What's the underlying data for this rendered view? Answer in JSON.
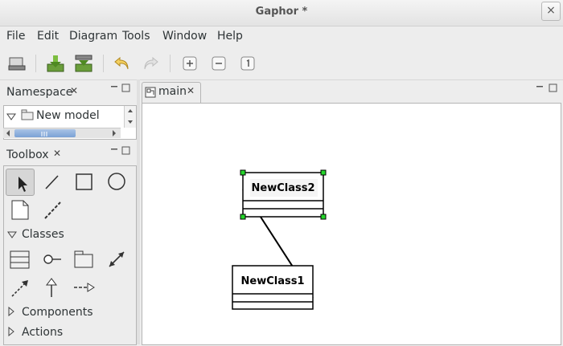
{
  "window": {
    "title": "Gaphor *",
    "close_glyph": "×"
  },
  "menu": [
    "File",
    "Edit",
    "Diagram",
    "Tools",
    "Window",
    "Help"
  ],
  "toolbar": {
    "buttons": [
      "open-model-icon",
      "import-icon",
      "export-icon",
      "undo-icon",
      "redo-icon",
      "zoom-in-icon",
      "zoom-out-icon",
      "zoom-100-icon"
    ]
  },
  "namespace": {
    "title": "Namespace",
    "tree": [
      {
        "label": "New model",
        "expanded": true
      }
    ]
  },
  "toolbox": {
    "title": "Toolbox",
    "sections": {
      "classes": "Classes",
      "components": "Components",
      "actions": "Actions"
    },
    "tools_row1": [
      "pointer-tool",
      "line-tool",
      "box-tool",
      "ellipse-tool"
    ],
    "tools_row2": [
      "comment-tool",
      "comment-line-tool"
    ],
    "class_tools_row1": [
      "class-tool",
      "interface-tool",
      "package-tool",
      "association-tool"
    ],
    "class_tools_row2": [
      "dependency-tool",
      "generalization-tool",
      "implementation-tool"
    ]
  },
  "diagram": {
    "tab_label": "main",
    "classes": [
      {
        "name": "NewClass2",
        "selected": true
      },
      {
        "name": "NewClass1",
        "selected": false
      }
    ]
  },
  "colors": {
    "handle": "#25d62b",
    "canvas": "#ffffff",
    "chrome": "#ededed"
  }
}
